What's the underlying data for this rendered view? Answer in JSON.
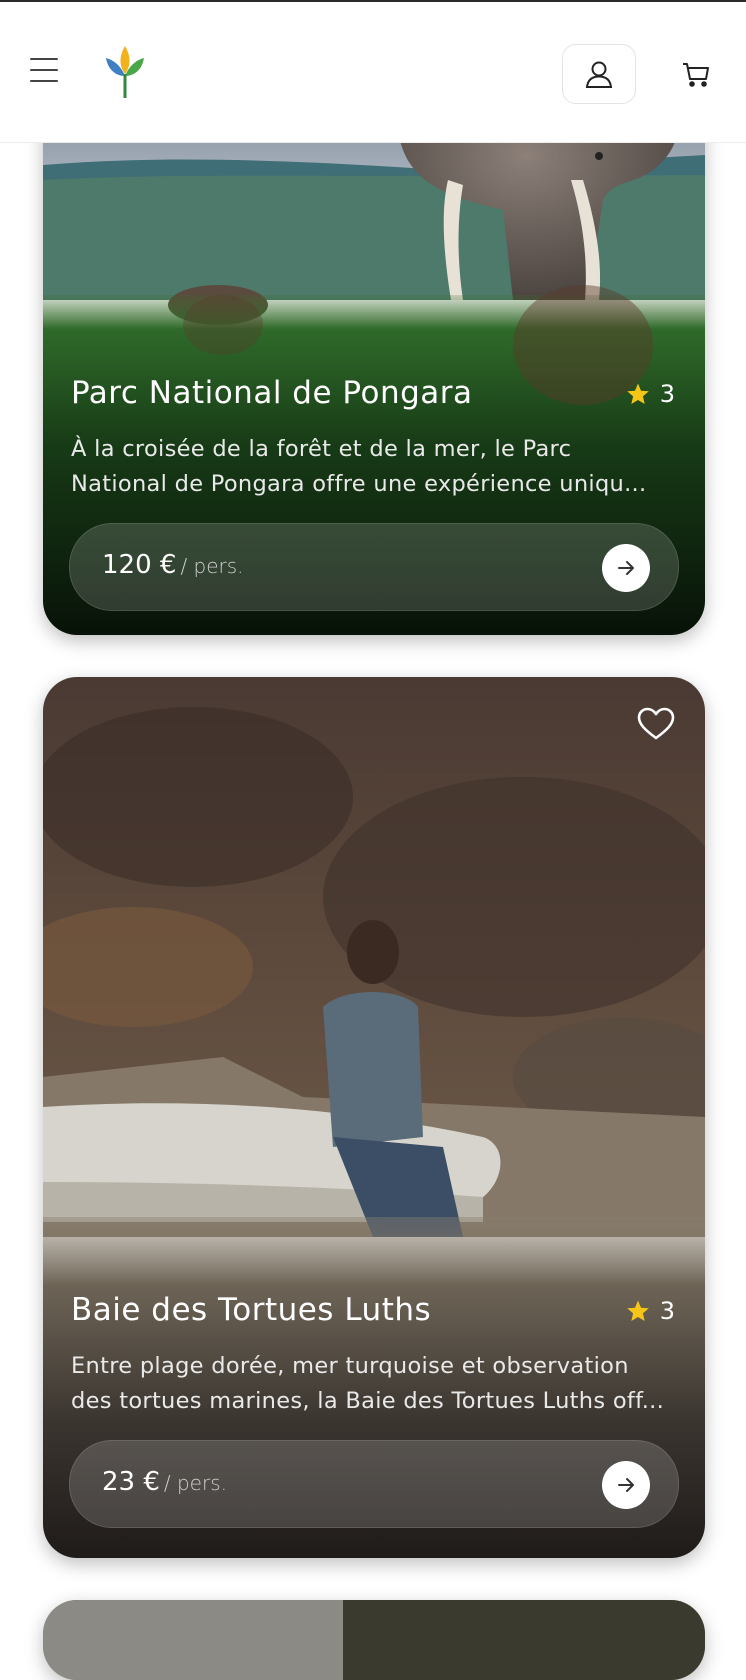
{
  "header": {
    "menu_icon": "hamburger-menu-icon",
    "logo_icon": "leaf-logo-icon",
    "account_icon": "user-icon",
    "cart_icon": "shopping-cart-icon"
  },
  "cards": [
    {
      "title": "Parc National de Pongara",
      "rating": "3",
      "description_line1": "À la croisée de la forêt et de la mer, le Parc",
      "description_line2": "National de Pongara offre une expérience uniqu...",
      "price": "120 €",
      "per": "/ pers."
    },
    {
      "title": "Baie des Tortues Luths",
      "rating": "3",
      "description_line1": "Entre plage dorée, mer turquoise et observation",
      "description_line2": "des tortues marines, la Baie des Tortues Luths off...",
      "price": "23 €",
      "per": "/ pers."
    }
  ],
  "colors": {
    "star": "#f5c518",
    "card1_bottom": "#0b1a0b",
    "card2_bottom": "#2a2522"
  }
}
